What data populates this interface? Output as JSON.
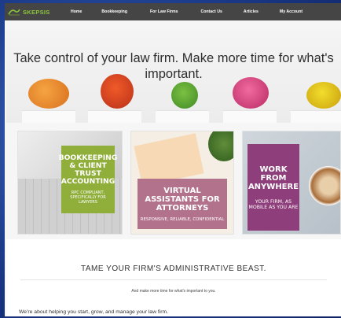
{
  "brand": {
    "name": "SKEPSIS",
    "accent": "#8cc63e"
  },
  "nav": {
    "items": [
      "Home",
      "Bookkeeping",
      "For Law Firms",
      "Contact Us",
      "Articles",
      "My Account"
    ]
  },
  "hero": {
    "title": "Take control of your law firm.  Make more time for what's important."
  },
  "cards": [
    {
      "title": "BOOKKEEPING & CLIENT TRUST ACCOUNTING",
      "subtitle": "RPC COMPLIANT, SPECIFICALLY FOR LAWYERS",
      "color": "#8fae3a"
    },
    {
      "title": "VIRTUAL ASSISTANTS FOR ATTORNEYS",
      "subtitle": "RESPONSIVE, RELIABLE, CONFIDENTIAL",
      "color": "#b3728c"
    },
    {
      "title": "WORK FROM ANYWHERE",
      "subtitle": "YOUR FIRM, AS MOBILE AS YOU ARE",
      "color": "#8e3f7b"
    }
  ],
  "tagline": {
    "title": "TAME YOUR FIRM'S ADMINISTRATIVE BEAST.",
    "subtitle": "And make more time for what's important to you."
  },
  "about": {
    "text": "We're about helping you start, grow, and manage your law firm."
  }
}
